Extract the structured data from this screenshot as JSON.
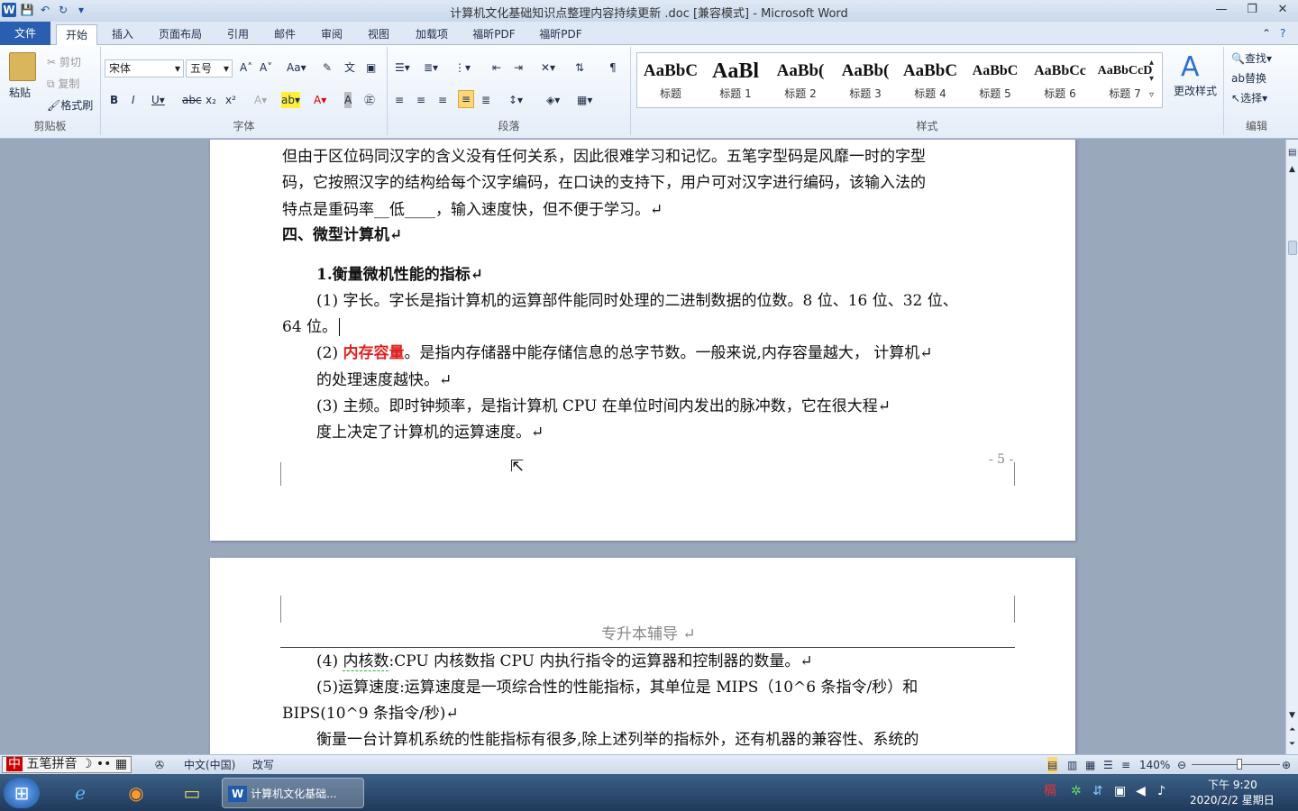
{
  "window": {
    "title": "计算机文化基础知识点整理内容持续更新 .doc [兼容模式] - Microsoft Word"
  },
  "qat": {
    "word": "W",
    "save": "💾",
    "undo": "↶",
    "redo": "↻",
    "more": "▾"
  },
  "winbtns": {
    "min": "—",
    "max": "❐",
    "close": "✕"
  },
  "tabs": [
    "文件",
    "开始",
    "插入",
    "页面布局",
    "引用",
    "邮件",
    "审阅",
    "视图",
    "加载项",
    "福昕PDF",
    "福昕PDF"
  ],
  "clipboard": {
    "paste": "粘贴",
    "cut": "剪切",
    "copy": "复制",
    "format_painter": "格式刷",
    "group": "剪贴板"
  },
  "font": {
    "name": "宋体",
    "size": "五号",
    "group": "字体"
  },
  "paragraph": {
    "group": "段落"
  },
  "styles": {
    "group": "样式",
    "items": [
      {
        "sample": "AaBbC",
        "name": "标题"
      },
      {
        "sample": "AaBl",
        "name": "标题 1"
      },
      {
        "sample": "AaBb(",
        "name": "标题 2"
      },
      {
        "sample": "AaBb(",
        "name": "标题 3"
      },
      {
        "sample": "AaBbC",
        "name": "标题 4"
      },
      {
        "sample": "AaBbC",
        "name": "标题 5"
      },
      {
        "sample": "AaBbCc",
        "name": "标题 6"
      },
      {
        "sample": "AaBbCcD",
        "name": "标题 7"
      }
    ],
    "change": "更改样式"
  },
  "editing": {
    "find": "查找",
    "replace": "替换",
    "select": "选择",
    "group": "编辑"
  },
  "doc": {
    "l1": "但由于区位码同汉字的含义没有任何关系，因此很难学习和记忆。五笔字型码是风靡一时的字型",
    "l2": "码，它按照汉字的结构给每个汉字编码，在口诀的支持下，用户可对汉字进行编码，该输入法的",
    "l3": "特点是重码率__低____，输入速度快，但不便于学习。↵",
    "h4": "四、微型计算机↵",
    "h1": "1.衡量微机性能的指标↵",
    "p1a": "(1)  字长。字长是指计算机的运算部件能同时处理的二进制数据的位数。8 位、16 位、32 位、",
    "p1b": "64 位。",
    "p2pre": "(2)  ",
    "p2red": "内存容量",
    "p2post": "。是指内存储器中能存储信息的总字节数。一般来说,内存容量越大， 计算机↵",
    "p2b": "的处理速度越快。↵",
    "p3a": "(3)  主频。即时钟频率，是指计算机 CPU  在单位时间内发出的脉冲数，它在很大程↵",
    "p3b": "度上决定了计算机的运算速度。↵",
    "pagenum": "- 5 -",
    "header": "专升本辅导 ↵",
    "p4pre": "(4)  ",
    "p4u": "内核数",
    "p4post": ":CPU  内核数指 CPU  内执行指令的运算器和控制器的数量。↵",
    "p5a": "(5)运算速度:运算速度是一项综合性的性能指标，其单位是  MIPS（10^6  条指令/秒）和",
    "p5b": "BIPS(10^9 条指令/秒)↵",
    "p6": "衡量一台计算机系统的性能指标有很多,除上述列举的指标外，还有机器的兼容性、系统的"
  },
  "status": {
    "ime": "五笔拼音",
    "lang": "中文(中国)",
    "mode": "改写",
    "zoom": "140%"
  },
  "taskbar": {
    "word_task": "计算机文化基础...",
    "time": "下午 9:20",
    "date": "2020/2/2 星期日"
  },
  "colors": {
    "accent": "#2a5eb0",
    "red_text": "#e02020"
  }
}
